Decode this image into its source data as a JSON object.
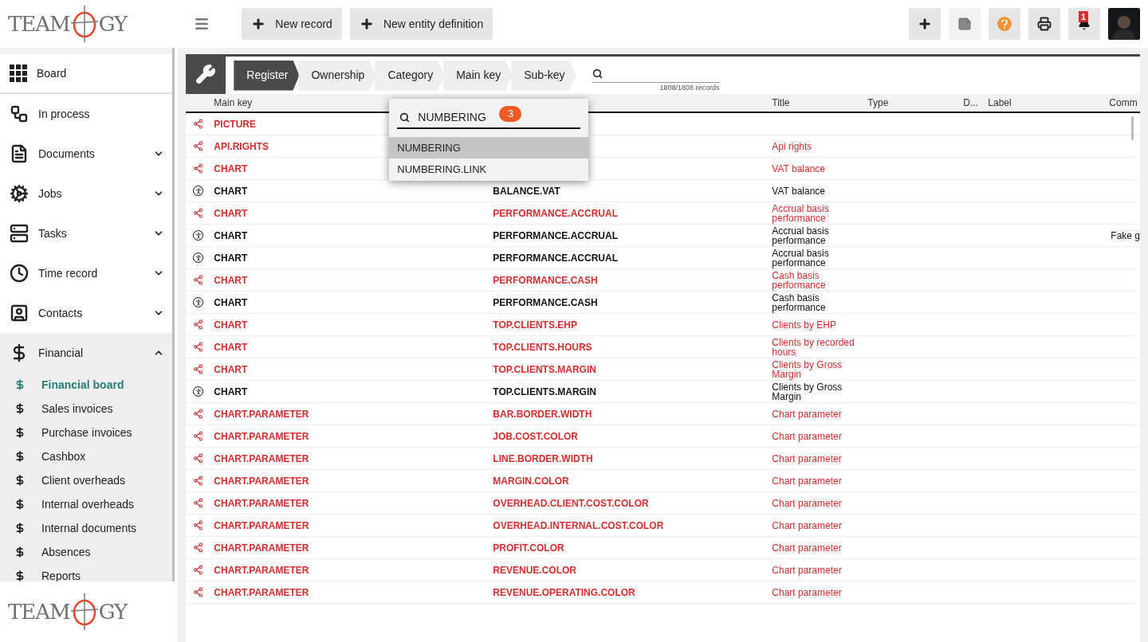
{
  "logos": [
    {
      "left": "TEAM",
      "right": "GY"
    },
    {
      "left": "TEAM",
      "right": "GY"
    }
  ],
  "toolbar": {
    "buttons": [
      "New record",
      "New entity definition"
    ]
  },
  "top_actions": {
    "notification_count": "1"
  },
  "sidebar": {
    "items": [
      {
        "label": "Board"
      },
      {
        "label": "In process"
      },
      {
        "label": "Documents",
        "expanded": false
      },
      {
        "label": "Jobs",
        "expanded": false
      },
      {
        "label": "Tasks",
        "expanded": false
      },
      {
        "label": "Time record",
        "expanded": false
      },
      {
        "label": "Contacts",
        "expanded": false
      },
      {
        "label": "Financial",
        "expanded": true,
        "children": [
          {
            "label": "Financial board",
            "selected": true
          },
          {
            "label": "Sales invoices",
            "selected": false
          },
          {
            "label": "Purchase invoices",
            "selected": false
          },
          {
            "label": "Cashbox",
            "selected": false
          },
          {
            "label": "Client overheads",
            "selected": false
          },
          {
            "label": "Internal overheads",
            "selected": false
          },
          {
            "label": "Internal documents",
            "selected": false
          },
          {
            "label": "Absences",
            "selected": false
          },
          {
            "label": "Reports",
            "selected": false
          }
        ]
      }
    ]
  },
  "breadcrumb": [
    {
      "label": "Register",
      "selected": true
    },
    {
      "label": "Ownership",
      "selected": false
    },
    {
      "label": "Category",
      "selected": false
    },
    {
      "label": "Main key",
      "selected": false
    },
    {
      "label": "Sub-key",
      "selected": false
    }
  ],
  "search": {
    "records": "1808/1808 records"
  },
  "table": {
    "header": {
      "main_key": "Main key",
      "title": "Title",
      "type": "Type",
      "column_6": "D...",
      "label": "Label",
      "comment": "Comm"
    },
    "rows": [
      {
        "kind": "shared",
        "main_key": "PICTURE"
      },
      {
        "kind": "shared",
        "main_key": "API.RIGHTS",
        "title": "Api rights"
      },
      {
        "kind": "shared",
        "main_key": "CHART",
        "title": "VAT balance"
      },
      {
        "kind": "user",
        "main_key": "CHART",
        "sub_key": "BALANCE.VAT",
        "title": "VAT balance"
      },
      {
        "kind": "shared",
        "main_key": "CHART",
        "sub_key": "PERFORMANCE.ACCRUAL",
        "title": "Accrual basis performance"
      },
      {
        "kind": "user",
        "main_key": "CHART",
        "sub_key": "PERFORMANCE.ACCRUAL",
        "title": "Accrual basis performance",
        "comment": "Fake g"
      },
      {
        "kind": "user",
        "main_key": "CHART",
        "sub_key": "PERFORMANCE.ACCRUAL",
        "title": "Accrual basis performance"
      },
      {
        "kind": "shared",
        "main_key": "CHART",
        "sub_key": "PERFORMANCE.CASH",
        "title": "Cash basis performance"
      },
      {
        "kind": "user",
        "main_key": "CHART",
        "sub_key": "PERFORMANCE.CASH",
        "title": "Cash basis performance"
      },
      {
        "kind": "shared",
        "main_key": "CHART",
        "sub_key": "TOP.CLIENTS.EHP",
        "title": "Clients by EHP"
      },
      {
        "kind": "shared",
        "main_key": "CHART",
        "sub_key": "TOP.CLIENTS.HOURS",
        "title": "Clients by recorded hours"
      },
      {
        "kind": "shared",
        "main_key": "CHART",
        "sub_key": "TOP.CLIENTS.MARGIN",
        "title": "Clients by Gross Margin"
      },
      {
        "kind": "user",
        "main_key": "CHART",
        "sub_key": "TOP.CLIENTS.MARGIN",
        "title": "Clients by Gross Margin"
      },
      {
        "kind": "shared",
        "main_key": "CHART.PARAMETER",
        "sub_key": "BAR.BORDER.WIDTH",
        "title": "Chart parameter"
      },
      {
        "kind": "shared",
        "main_key": "CHART.PARAMETER",
        "sub_key": "JOB.COST.COLOR",
        "title": "Chart parameter"
      },
      {
        "kind": "shared",
        "main_key": "CHART.PARAMETER",
        "sub_key": "LINE.BORDER.WIDTH",
        "title": "Chart parameter"
      },
      {
        "kind": "shared",
        "main_key": "CHART.PARAMETER",
        "sub_key": "MARGIN.COLOR",
        "title": "Chart parameter"
      },
      {
        "kind": "shared",
        "main_key": "CHART.PARAMETER",
        "sub_key": "OVERHEAD.CLIENT.COST.COLOR",
        "title": "Chart parameter"
      },
      {
        "kind": "shared",
        "main_key": "CHART.PARAMETER",
        "sub_key": "OVERHEAD.INTERNAL.COST.COLOR",
        "title": "Chart parameter"
      },
      {
        "kind": "shared",
        "main_key": "CHART.PARAMETER",
        "sub_key": "PROFIT.COLOR",
        "title": "Chart parameter"
      },
      {
        "kind": "shared",
        "main_key": "CHART.PARAMETER",
        "sub_key": "REVENUE.COLOR",
        "title": "Chart parameter"
      },
      {
        "kind": "shared",
        "main_key": "CHART.PARAMETER",
        "sub_key": "REVENUE.OPERATING.COLOR",
        "title": "Chart parameter"
      }
    ]
  },
  "dropdown": {
    "query": "NUMBERING",
    "count": "3",
    "options": [
      {
        "label": "NUMBERING",
        "selected": true
      },
      {
        "label": "NUMBERING.LINK",
        "selected": false
      }
    ]
  }
}
